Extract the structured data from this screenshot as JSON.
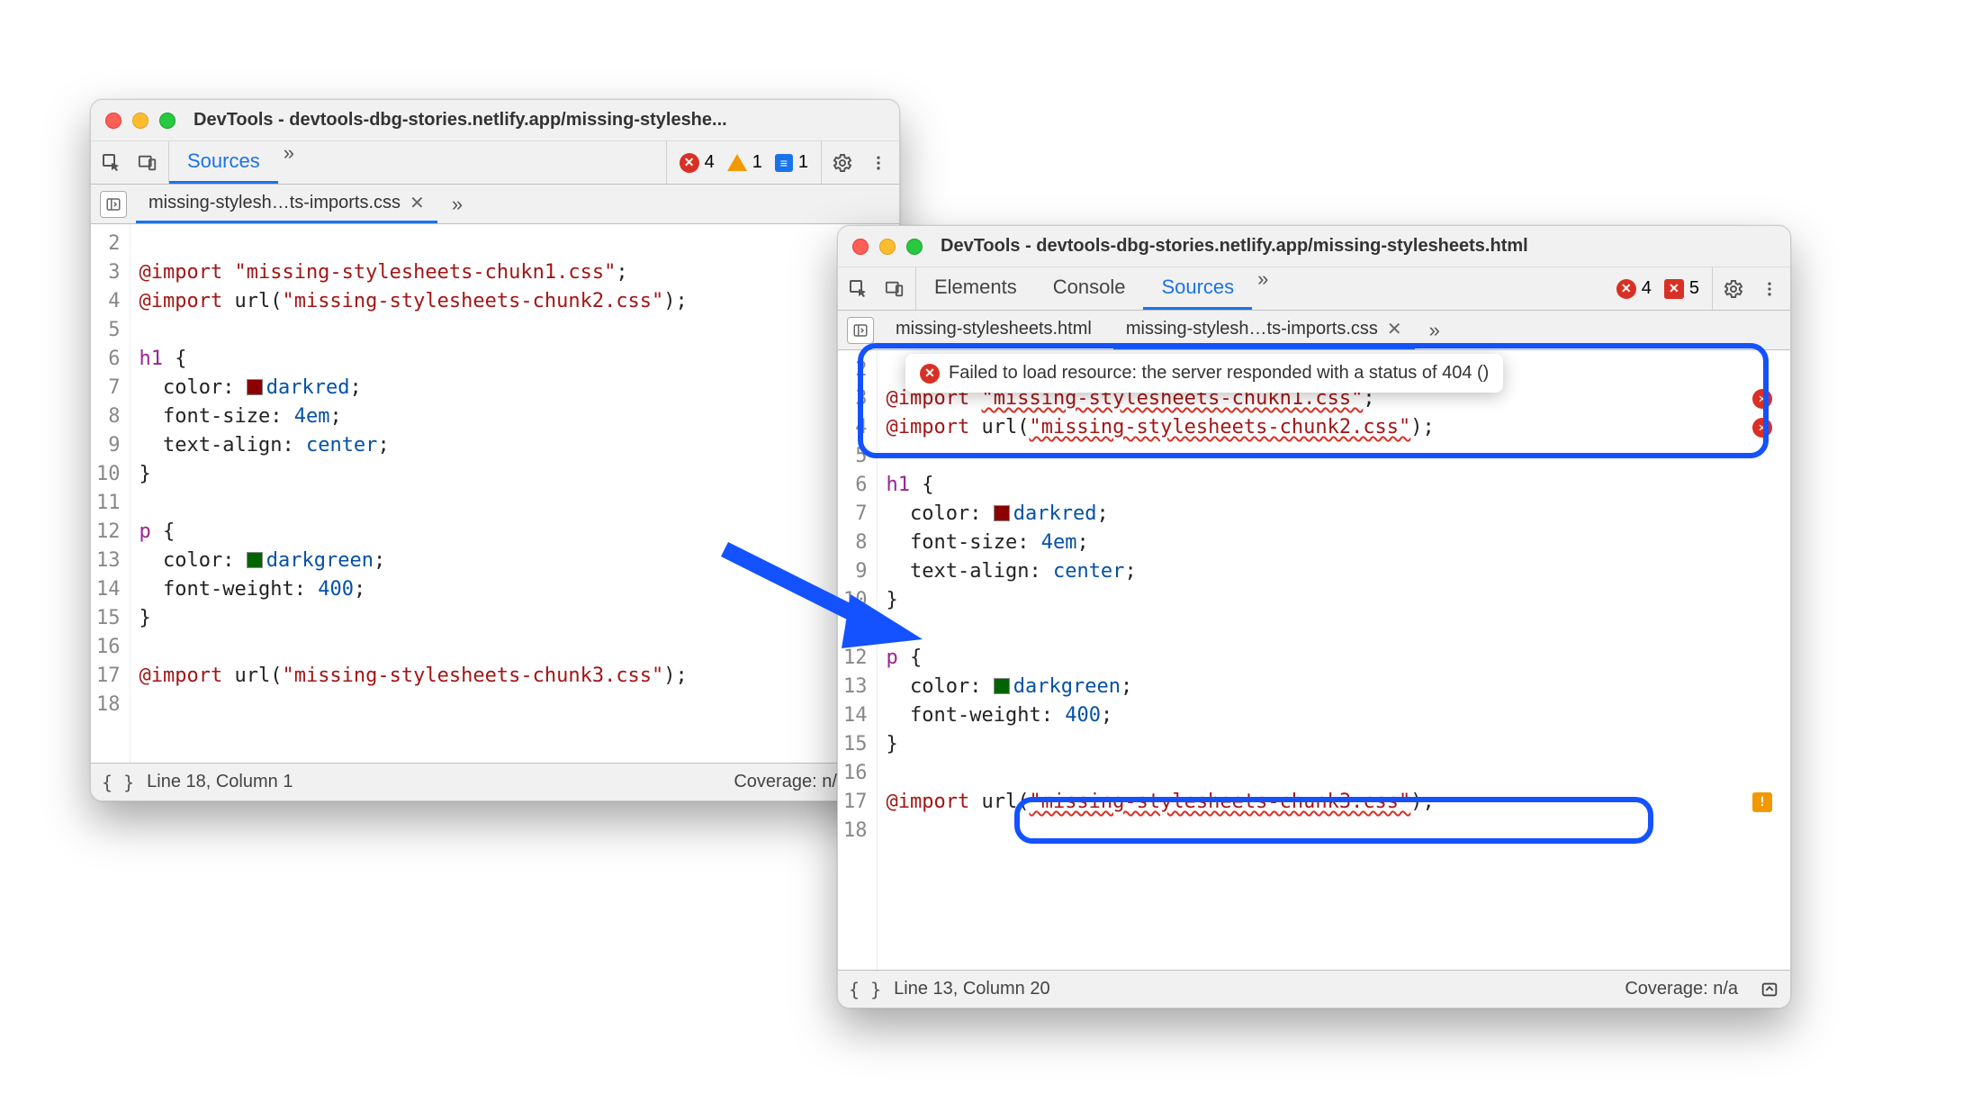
{
  "windows": {
    "left": {
      "title": "DevTools - devtools-dbg-stories.netlify.app/missing-styleshe...",
      "active_panel": "Sources",
      "counts": {
        "errors": "4",
        "warnings": "1",
        "info": "1"
      },
      "file_tab": "missing-stylesh…ts-imports.css",
      "more_files": "»",
      "status": {
        "pos": "Line 18, Column 1",
        "coverage": "Coverage: n/a"
      }
    },
    "right": {
      "title": "DevTools - devtools-dbg-stories.netlify.app/missing-stylesheets.html",
      "panels": [
        "Elements",
        "Console",
        "Sources"
      ],
      "active_panel": "Sources",
      "counts": {
        "errors": "4",
        "issues": "5"
      },
      "file_tabs": [
        "missing-stylesheets.html",
        "missing-stylesh…ts-imports.css"
      ],
      "more_files": "»",
      "tooltip": "Failed to load resource: the server responded with a status of 404 ()",
      "status": {
        "pos": "Line 13, Column 20",
        "coverage": "Coverage: n/a"
      }
    }
  },
  "code": {
    "first_blank_num": "2",
    "lines_start": 3,
    "lines": [
      {
        "n": "3",
        "type": "import",
        "segments": [
          [
            "at",
            "@import "
          ],
          [
            "str",
            "\"missing-stylesheets-chukn1.css\""
          ],
          [
            "p",
            ";"
          ]
        ],
        "err": true
      },
      {
        "n": "4",
        "type": "importurl",
        "segments": [
          [
            "at",
            "@import "
          ],
          [
            "prop",
            "url("
          ],
          [
            "str",
            "\"missing-stylesheets-chunk2.css\""
          ],
          [
            "prop",
            ")"
          ],
          [
            "p",
            ";"
          ]
        ],
        "err": true
      },
      {
        "n": "5",
        "blank": true
      },
      {
        "n": "6",
        "segments": [
          [
            "sel",
            "h1 "
          ],
          [
            "p",
            "{"
          ]
        ]
      },
      {
        "n": "7",
        "segments": [
          [
            "indent",
            "  "
          ],
          [
            "prop",
            "color"
          ],
          [
            "p",
            ": "
          ],
          [
            "swatch",
            "#8b0000"
          ],
          [
            "val",
            "darkred"
          ],
          [
            "p",
            ";"
          ]
        ]
      },
      {
        "n": "8",
        "segments": [
          [
            "indent",
            "  "
          ],
          [
            "prop",
            "font-size"
          ],
          [
            "p",
            ": "
          ],
          [
            "num",
            "4em"
          ],
          [
            "p",
            ";"
          ]
        ]
      },
      {
        "n": "9",
        "segments": [
          [
            "indent",
            "  "
          ],
          [
            "prop",
            "text-align"
          ],
          [
            "p",
            ": "
          ],
          [
            "val",
            "center"
          ],
          [
            "p",
            ";"
          ]
        ]
      },
      {
        "n": "10",
        "segments": [
          [
            "p",
            "}"
          ]
        ]
      },
      {
        "n": "11",
        "blank": true
      },
      {
        "n": "12",
        "segments": [
          [
            "sel",
            "p "
          ],
          [
            "p",
            "{"
          ]
        ]
      },
      {
        "n": "13",
        "segments": [
          [
            "indent",
            "  "
          ],
          [
            "prop",
            "color"
          ],
          [
            "p",
            ": "
          ],
          [
            "swatch",
            "#006400"
          ],
          [
            "val",
            "darkgreen"
          ],
          [
            "p",
            ";"
          ]
        ]
      },
      {
        "n": "14",
        "segments": [
          [
            "indent",
            "  "
          ],
          [
            "prop",
            "font-weight"
          ],
          [
            "p",
            ": "
          ],
          [
            "num",
            "400"
          ],
          [
            "p",
            ";"
          ]
        ]
      },
      {
        "n": "15",
        "segments": [
          [
            "p",
            "}"
          ]
        ]
      },
      {
        "n": "16",
        "blank": true
      },
      {
        "n": "17",
        "segments": [
          [
            "at",
            "@import "
          ],
          [
            "prop",
            "url("
          ],
          [
            "str",
            "\"missing-stylesheets-chunk3.css\""
          ],
          [
            "prop",
            ")"
          ],
          [
            "p",
            ";"
          ]
        ],
        "warn": true
      },
      {
        "n": "18",
        "blank": true
      }
    ]
  }
}
